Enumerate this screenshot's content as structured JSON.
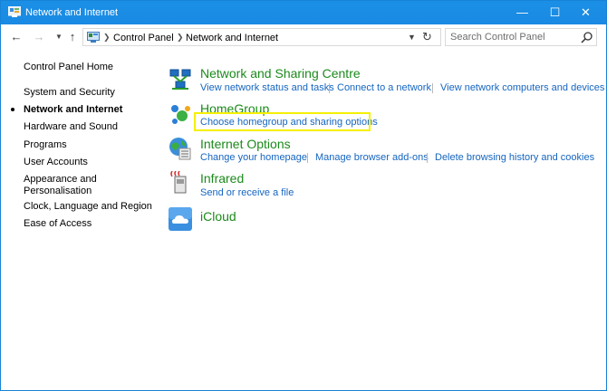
{
  "window": {
    "title": "Network and Internet",
    "controls": {
      "minimize": "—",
      "maximize": "☐",
      "close": "✕"
    }
  },
  "address_bar": {
    "crumbs": [
      "Control Panel",
      "Network and Internet"
    ],
    "search_placeholder": "Search Control Panel"
  },
  "sidebar": {
    "items": [
      {
        "label": "Control Panel Home"
      },
      {
        "label": "System and Security"
      },
      {
        "label": "Network and Internet",
        "active": true
      },
      {
        "label": "Hardware and Sound"
      },
      {
        "label": "Programs"
      },
      {
        "label": "User Accounts"
      },
      {
        "label": "Appearance and\nPersonalisation"
      },
      {
        "label": "Clock, Language and Region"
      },
      {
        "label": "Ease of Access"
      }
    ]
  },
  "categories": [
    {
      "title": "Network and Sharing Centre",
      "icon": "network-sharing-icon",
      "links": [
        "View network status and tasks",
        "Connect to a network",
        "View network computers and devices"
      ]
    },
    {
      "title": "HomeGroup",
      "icon": "homegroup-icon",
      "links": [
        "Choose homegroup and sharing options"
      ]
    },
    {
      "title": "Internet Options",
      "icon": "internet-options-icon",
      "links": [
        "Change your homepage",
        "Manage browser add-ons",
        "Delete browsing history and cookies"
      ]
    },
    {
      "title": "Infrared",
      "icon": "infrared-icon",
      "links": [
        "Send or receive a file"
      ]
    },
    {
      "title": "iCloud",
      "icon": "icloud-icon",
      "links": []
    }
  ],
  "colors": {
    "titlebar": "#1a8ae3",
    "category_title": "#1c8a1c",
    "link": "#1565c0",
    "highlight": "#f5f000"
  }
}
